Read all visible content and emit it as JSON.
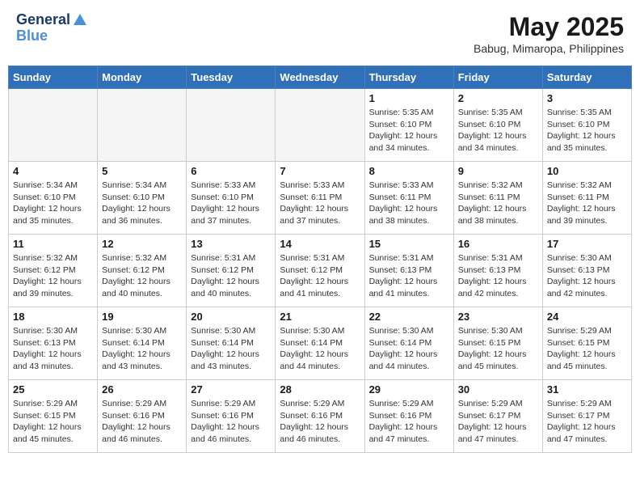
{
  "header": {
    "logo_line1": "General",
    "logo_line2": "Blue",
    "month_year": "May 2025",
    "location": "Babug, Mimaropa, Philippines"
  },
  "weekdays": [
    "Sunday",
    "Monday",
    "Tuesday",
    "Wednesday",
    "Thursday",
    "Friday",
    "Saturday"
  ],
  "weeks": [
    [
      {
        "day": "",
        "info": "",
        "empty": true
      },
      {
        "day": "",
        "info": "",
        "empty": true
      },
      {
        "day": "",
        "info": "",
        "empty": true
      },
      {
        "day": "",
        "info": "",
        "empty": true
      },
      {
        "day": "1",
        "info": "Sunrise: 5:35 AM\nSunset: 6:10 PM\nDaylight: 12 hours\nand 34 minutes.",
        "empty": false
      },
      {
        "day": "2",
        "info": "Sunrise: 5:35 AM\nSunset: 6:10 PM\nDaylight: 12 hours\nand 34 minutes.",
        "empty": false
      },
      {
        "day": "3",
        "info": "Sunrise: 5:35 AM\nSunset: 6:10 PM\nDaylight: 12 hours\nand 35 minutes.",
        "empty": false
      }
    ],
    [
      {
        "day": "4",
        "info": "Sunrise: 5:34 AM\nSunset: 6:10 PM\nDaylight: 12 hours\nand 35 minutes.",
        "empty": false
      },
      {
        "day": "5",
        "info": "Sunrise: 5:34 AM\nSunset: 6:10 PM\nDaylight: 12 hours\nand 36 minutes.",
        "empty": false
      },
      {
        "day": "6",
        "info": "Sunrise: 5:33 AM\nSunset: 6:10 PM\nDaylight: 12 hours\nand 37 minutes.",
        "empty": false
      },
      {
        "day": "7",
        "info": "Sunrise: 5:33 AM\nSunset: 6:11 PM\nDaylight: 12 hours\nand 37 minutes.",
        "empty": false
      },
      {
        "day": "8",
        "info": "Sunrise: 5:33 AM\nSunset: 6:11 PM\nDaylight: 12 hours\nand 38 minutes.",
        "empty": false
      },
      {
        "day": "9",
        "info": "Sunrise: 5:32 AM\nSunset: 6:11 PM\nDaylight: 12 hours\nand 38 minutes.",
        "empty": false
      },
      {
        "day": "10",
        "info": "Sunrise: 5:32 AM\nSunset: 6:11 PM\nDaylight: 12 hours\nand 39 minutes.",
        "empty": false
      }
    ],
    [
      {
        "day": "11",
        "info": "Sunrise: 5:32 AM\nSunset: 6:12 PM\nDaylight: 12 hours\nand 39 minutes.",
        "empty": false
      },
      {
        "day": "12",
        "info": "Sunrise: 5:32 AM\nSunset: 6:12 PM\nDaylight: 12 hours\nand 40 minutes.",
        "empty": false
      },
      {
        "day": "13",
        "info": "Sunrise: 5:31 AM\nSunset: 6:12 PM\nDaylight: 12 hours\nand 40 minutes.",
        "empty": false
      },
      {
        "day": "14",
        "info": "Sunrise: 5:31 AM\nSunset: 6:12 PM\nDaylight: 12 hours\nand 41 minutes.",
        "empty": false
      },
      {
        "day": "15",
        "info": "Sunrise: 5:31 AM\nSunset: 6:13 PM\nDaylight: 12 hours\nand 41 minutes.",
        "empty": false
      },
      {
        "day": "16",
        "info": "Sunrise: 5:31 AM\nSunset: 6:13 PM\nDaylight: 12 hours\nand 42 minutes.",
        "empty": false
      },
      {
        "day": "17",
        "info": "Sunrise: 5:30 AM\nSunset: 6:13 PM\nDaylight: 12 hours\nand 42 minutes.",
        "empty": false
      }
    ],
    [
      {
        "day": "18",
        "info": "Sunrise: 5:30 AM\nSunset: 6:13 PM\nDaylight: 12 hours\nand 43 minutes.",
        "empty": false
      },
      {
        "day": "19",
        "info": "Sunrise: 5:30 AM\nSunset: 6:14 PM\nDaylight: 12 hours\nand 43 minutes.",
        "empty": false
      },
      {
        "day": "20",
        "info": "Sunrise: 5:30 AM\nSunset: 6:14 PM\nDaylight: 12 hours\nand 43 minutes.",
        "empty": false
      },
      {
        "day": "21",
        "info": "Sunrise: 5:30 AM\nSunset: 6:14 PM\nDaylight: 12 hours\nand 44 minutes.",
        "empty": false
      },
      {
        "day": "22",
        "info": "Sunrise: 5:30 AM\nSunset: 6:14 PM\nDaylight: 12 hours\nand 44 minutes.",
        "empty": false
      },
      {
        "day": "23",
        "info": "Sunrise: 5:30 AM\nSunset: 6:15 PM\nDaylight: 12 hours\nand 45 minutes.",
        "empty": false
      },
      {
        "day": "24",
        "info": "Sunrise: 5:29 AM\nSunset: 6:15 PM\nDaylight: 12 hours\nand 45 minutes.",
        "empty": false
      }
    ],
    [
      {
        "day": "25",
        "info": "Sunrise: 5:29 AM\nSunset: 6:15 PM\nDaylight: 12 hours\nand 45 minutes.",
        "empty": false
      },
      {
        "day": "26",
        "info": "Sunrise: 5:29 AM\nSunset: 6:16 PM\nDaylight: 12 hours\nand 46 minutes.",
        "empty": false
      },
      {
        "day": "27",
        "info": "Sunrise: 5:29 AM\nSunset: 6:16 PM\nDaylight: 12 hours\nand 46 minutes.",
        "empty": false
      },
      {
        "day": "28",
        "info": "Sunrise: 5:29 AM\nSunset: 6:16 PM\nDaylight: 12 hours\nand 46 minutes.",
        "empty": false
      },
      {
        "day": "29",
        "info": "Sunrise: 5:29 AM\nSunset: 6:16 PM\nDaylight: 12 hours\nand 47 minutes.",
        "empty": false
      },
      {
        "day": "30",
        "info": "Sunrise: 5:29 AM\nSunset: 6:17 PM\nDaylight: 12 hours\nand 47 minutes.",
        "empty": false
      },
      {
        "day": "31",
        "info": "Sunrise: 5:29 AM\nSunset: 6:17 PM\nDaylight: 12 hours\nand 47 minutes.",
        "empty": false
      }
    ]
  ]
}
